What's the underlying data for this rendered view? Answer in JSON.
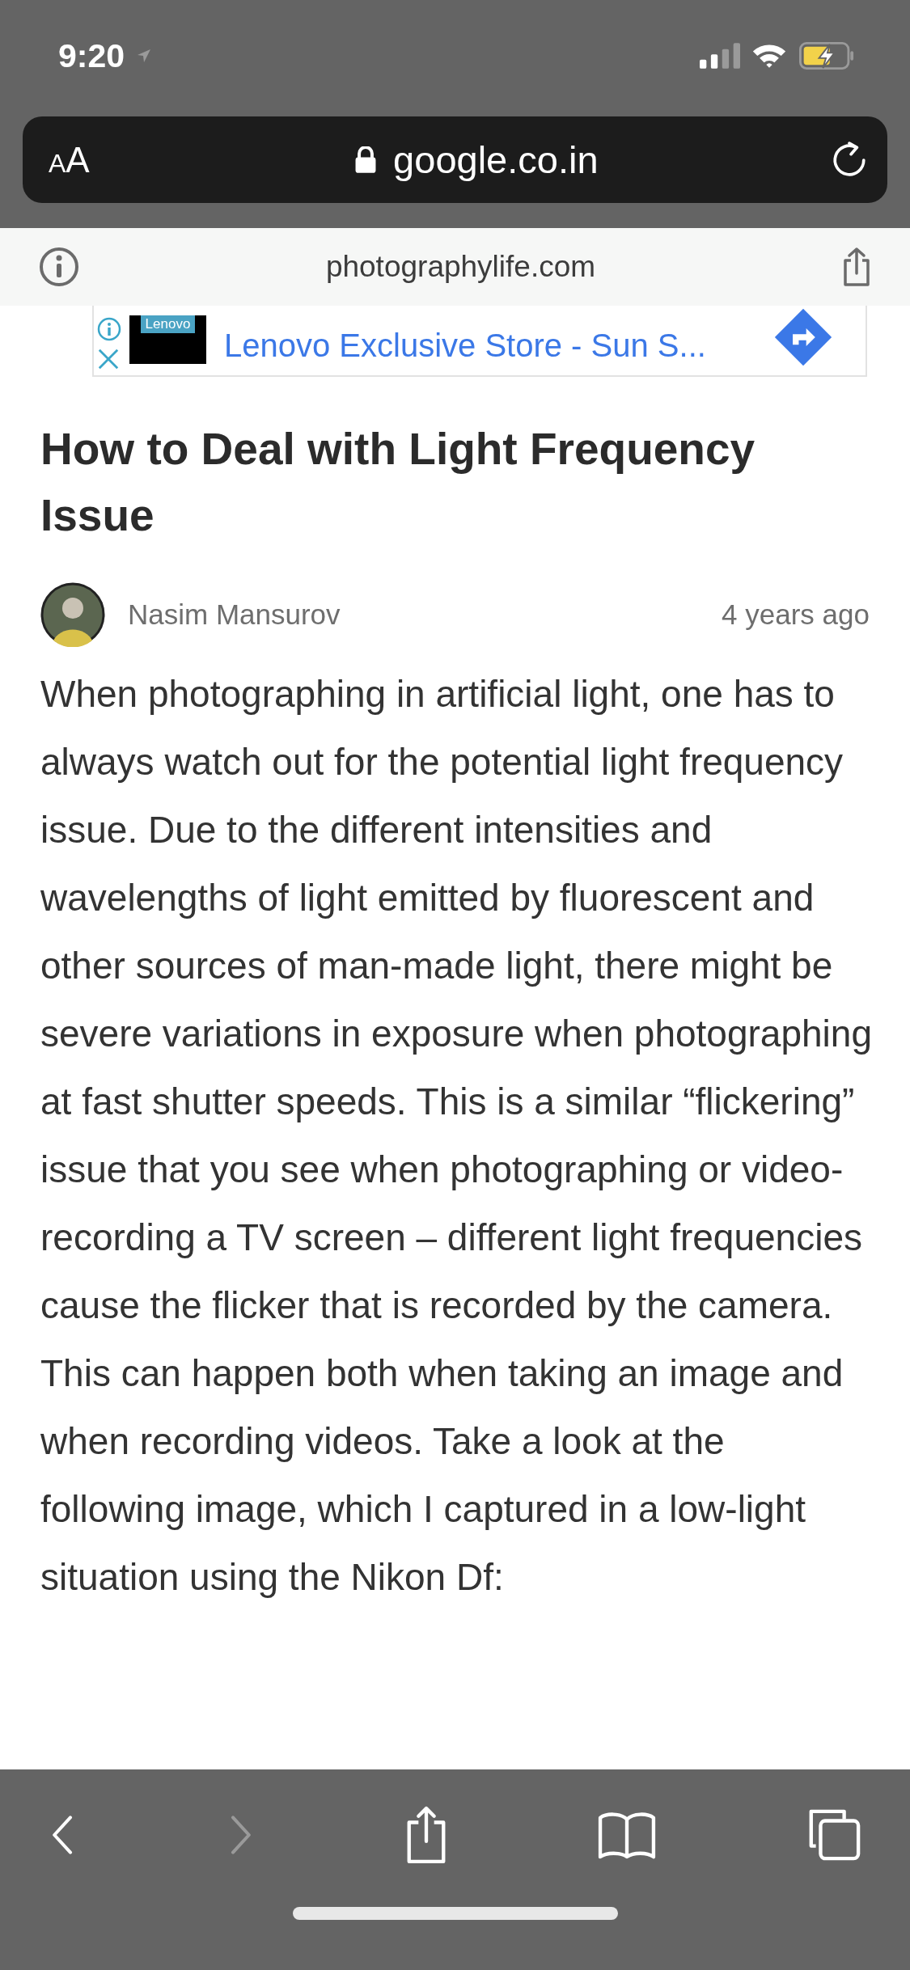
{
  "status_bar": {
    "time": "9:20"
  },
  "address_bar": {
    "text_size_button": "AA",
    "url": "google.co.in"
  },
  "site_bar": {
    "domain": "photographylife.com"
  },
  "ad": {
    "logo_text": "Lenovo",
    "link": "Lenovo Exclusive Store - Sun S..."
  },
  "article": {
    "title": "How to Deal with Light Frequency Issue",
    "author": "Nasim Mansurov",
    "date": "4 years ago",
    "body": "When photographing in artificial light, one has to always watch out for the potential light frequency issue. Due to the different intensities and wavelengths of light emitted by fluorescent and other sources of man-made light, there might be severe variations in exposure when photographing at fast shutter speeds. This is a similar “flickering” issue that you see when photographing or video-recording a TV screen – different light frequencies cause the flicker that is recorded by the camera. This can happen both when taking an image and when recording videos. Take a look at the following image, which I captured in a low-light situation using the Nikon Df:"
  },
  "toolbar": [
    {
      "kind": "back",
      "disabled": false
    },
    {
      "kind": "forward",
      "disabled": true
    },
    {
      "kind": "share",
      "disabled": false
    },
    {
      "kind": "bookmarks",
      "disabled": false
    },
    {
      "kind": "tabs",
      "disabled": false
    }
  ]
}
